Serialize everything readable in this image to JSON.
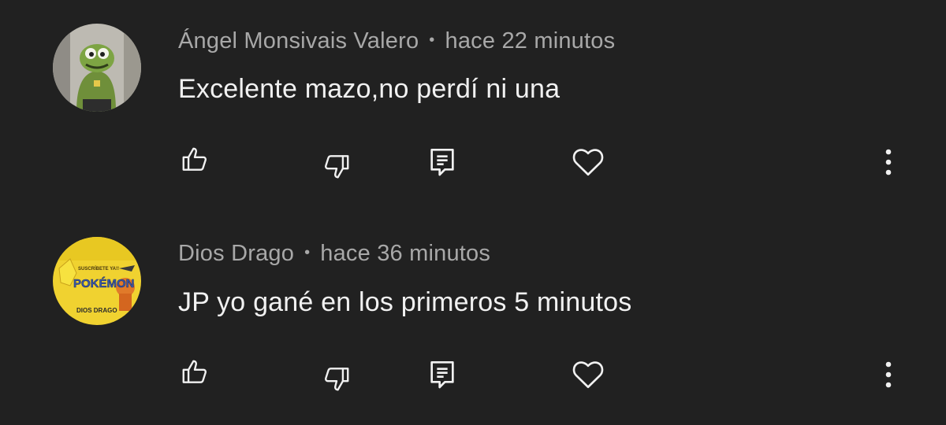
{
  "colors": {
    "background": "#212121",
    "author": "#a8a8a8",
    "text": "#f1f1f1",
    "icon": "#f1f1f1"
  },
  "comments": [
    {
      "author": "Ángel Monsivais Valero",
      "separator": "•",
      "time": "hace 22 minutos",
      "text": "Excelente mazo,no perdí ni una",
      "avatar": "cartoon-character-avatar",
      "actions": [
        "thumbs-up-icon",
        "thumbs-down-icon",
        "reply-icon",
        "heart-icon",
        "more-icon"
      ]
    },
    {
      "author": "Dios Drago",
      "separator": "•",
      "time": "hace 36 minutos",
      "text": "JP yo gané en los primeros 5 minutos",
      "avatar": "pokemon-channel-avatar",
      "avatar_text": [
        "SUSCRÍBETE YA!!",
        "POKÉMON",
        "DIOS DRAGO"
      ],
      "actions": [
        "thumbs-up-icon",
        "thumbs-down-icon",
        "reply-icon",
        "heart-icon",
        "more-icon"
      ]
    }
  ]
}
